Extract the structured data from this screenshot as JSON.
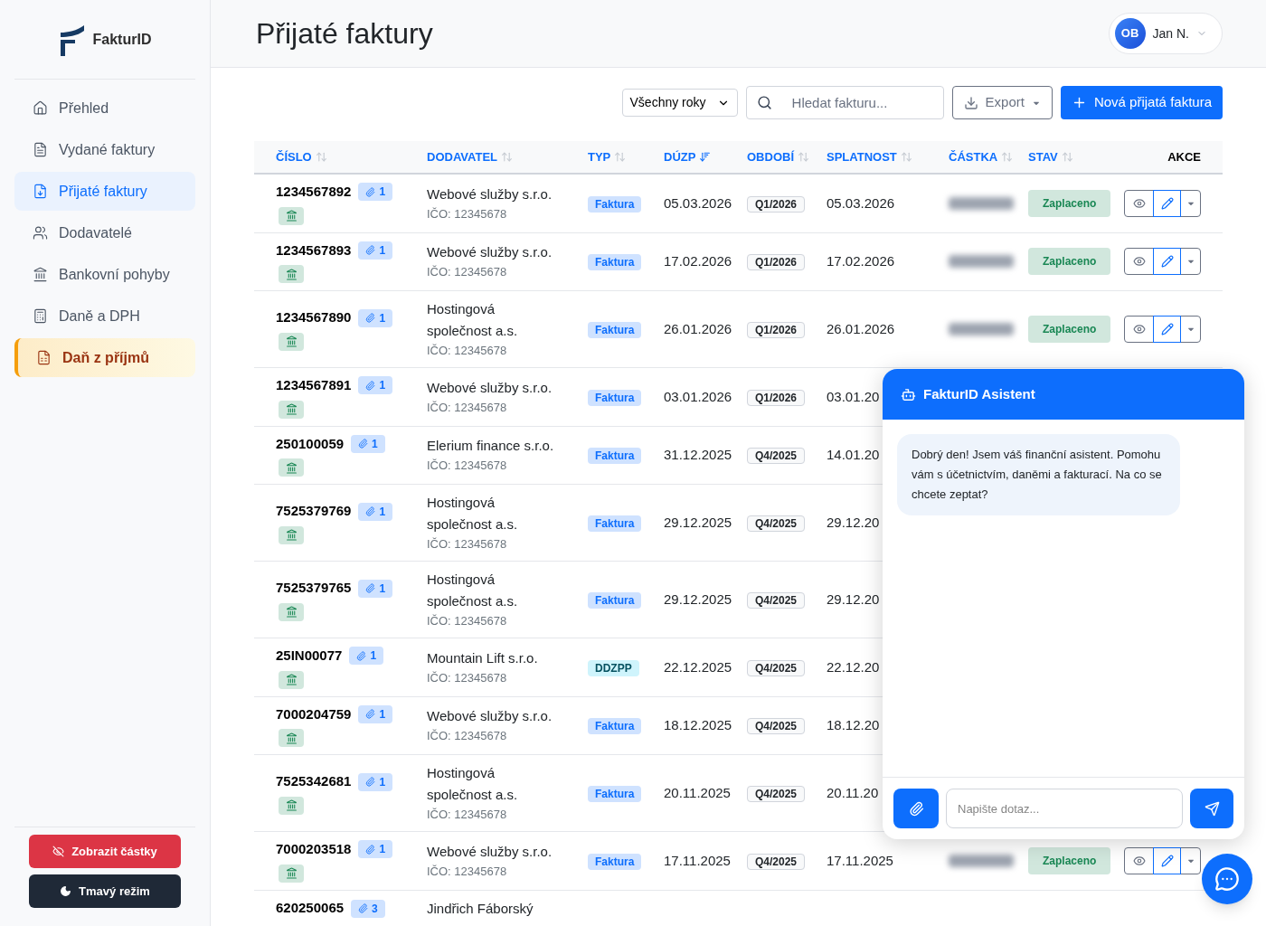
{
  "brand": "FakturID",
  "sidebar": {
    "items": [
      {
        "label": "Přehled",
        "selected": false,
        "kind": "normal"
      },
      {
        "label": "Vydané faktury",
        "selected": false,
        "kind": "normal"
      },
      {
        "label": "Přijaté faktury",
        "selected": true,
        "kind": "normal"
      },
      {
        "label": "Dodavatelé",
        "selected": false,
        "kind": "normal"
      },
      {
        "label": "Bankovní pohyby",
        "selected": false,
        "kind": "normal"
      },
      {
        "label": "Daně a DPH",
        "selected": false,
        "kind": "normal"
      },
      {
        "label": "Daň z příjmů",
        "selected": false,
        "kind": "featured"
      }
    ],
    "buttons": [
      {
        "label": "Zobrazit částky",
        "kind": "amounts"
      },
      {
        "label": "Tmavý režim",
        "kind": "dark"
      }
    ]
  },
  "page_title": "Přijaté faktury",
  "user": {
    "initials": "OB",
    "name": "Jan N."
  },
  "toolbar": {
    "year_select": "Všechny roky",
    "search": {
      "placeholder": "Hledat fakturu..."
    },
    "export": "Export",
    "new_button": "Nová přijatá faktura"
  },
  "amounts_hidden": true,
  "table": {
    "columns": [
      {
        "label": "ČÍSLO",
        "sorted": false
      },
      {
        "label": "DODAVATEL",
        "sorted": false
      },
      {
        "label": "TYP",
        "sorted": false
      },
      {
        "label": "DÚZP",
        "sorted": true
      },
      {
        "label": "OBDOBÍ",
        "sorted": false
      },
      {
        "label": "SPLATNOST",
        "sorted": false
      },
      {
        "label": "ČÁSTKA",
        "sorted": false
      },
      {
        "label": "STAV",
        "sorted": false
      },
      {
        "label": "AKCE"
      }
    ],
    "rows": [
      {
        "cislo": "1234567892",
        "attachments": "1",
        "dodavatel": "Webové služby s.r.o.",
        "ico": "IČO: 12345678",
        "typ": {
          "label": "Faktura",
          "kind": "invoice"
        },
        "duzp": "05.03.2026",
        "obdobi": "Q1/2026",
        "splatnost": "05.03.2026",
        "stav": "Zaplaceno"
      },
      {
        "cislo": "1234567893",
        "attachments": "1",
        "dodavatel": "Webové služby s.r.o.",
        "ico": "IČO: 12345678",
        "typ": {
          "label": "Faktura",
          "kind": "invoice"
        },
        "duzp": "17.02.2026",
        "obdobi": "Q1/2026",
        "splatnost": "17.02.2026",
        "stav": "Zaplaceno"
      },
      {
        "cislo": "1234567890",
        "attachments": "1",
        "dodavatel": "Hostingová společnost a.s.",
        "ico": "IČO: 12345678",
        "typ": {
          "label": "Faktura",
          "kind": "invoice"
        },
        "duzp": "26.01.2026",
        "obdobi": "Q1/2026",
        "splatnost": "26.01.2026",
        "stav": "Zaplaceno"
      },
      {
        "cislo": "1234567891",
        "attachments": "1",
        "dodavatel": "Webové služby s.r.o.",
        "ico": "IČO: 12345678",
        "typ": {
          "label": "Faktura",
          "kind": "invoice"
        },
        "duzp": "03.01.2026",
        "obdobi": "Q1/2026",
        "splatnost": "03.01.20"
      },
      {
        "cislo": "250100059",
        "attachments": "1",
        "dodavatel": "Elerium finance s.r.o.",
        "ico": "IČO: 12345678",
        "typ": {
          "label": "Faktura",
          "kind": "invoice"
        },
        "duzp": "31.12.2025",
        "obdobi": "Q4/2025",
        "splatnost": "14.01.20"
      },
      {
        "cislo": "7525379769",
        "attachments": "1",
        "dodavatel": "Hostingová společnost a.s.",
        "ico": "IČO: 12345678",
        "typ": {
          "label": "Faktura",
          "kind": "invoice"
        },
        "duzp": "29.12.2025",
        "obdobi": "Q4/2025",
        "splatnost": "29.12.20"
      },
      {
        "cislo": "7525379765",
        "attachments": "1",
        "dodavatel": "Hostingová společnost a.s.",
        "ico": "IČO: 12345678",
        "typ": {
          "label": "Faktura",
          "kind": "invoice"
        },
        "duzp": "29.12.2025",
        "obdobi": "Q4/2025",
        "splatnost": "29.12.20"
      },
      {
        "cislo": "25IN00077",
        "attachments": "1",
        "dodavatel": "Mountain Lift s.r.o.",
        "ico": "IČO: 12345678",
        "typ": {
          "label": "DDZPP",
          "kind": "advance"
        },
        "duzp": "22.12.2025",
        "obdobi": "Q4/2025",
        "splatnost": "22.12.20"
      },
      {
        "cislo": "7000204759",
        "attachments": "1",
        "dodavatel": "Webové služby s.r.o.",
        "ico": "IČO: 12345678",
        "typ": {
          "label": "Faktura",
          "kind": "invoice"
        },
        "duzp": "18.12.2025",
        "obdobi": "Q4/2025",
        "splatnost": "18.12.20"
      },
      {
        "cislo": "7525342681",
        "attachments": "1",
        "dodavatel": "Hostingová společnost a.s.",
        "ico": "IČO: 12345678",
        "typ": {
          "label": "Faktura",
          "kind": "invoice"
        },
        "duzp": "20.11.2025",
        "obdobi": "Q4/2025",
        "splatnost": "20.11.20"
      },
      {
        "cislo": "7000203518",
        "attachments": "1",
        "dodavatel": "Webové služby s.r.o.",
        "ico": "IČO: 12345678",
        "typ": {
          "label": "Faktura",
          "kind": "invoice"
        },
        "duzp": "17.11.2025",
        "obdobi": "Q4/2025",
        "splatnost": "17.11.2025",
        "stav": "Zaplaceno"
      },
      {
        "cislo": "620250065",
        "attachments": "3",
        "dodavatel": "Jindřich Fáborský"
      }
    ]
  },
  "assistant": {
    "title": "FakturID Asistent",
    "message": "Dobrý den! Jsem váš finanční asistent. Pomohu vám s účetnictvím, daněmi a fakturací. Na co se chcete zeptat?",
    "input": {
      "placeholder": "Napište dotaz..."
    }
  }
}
